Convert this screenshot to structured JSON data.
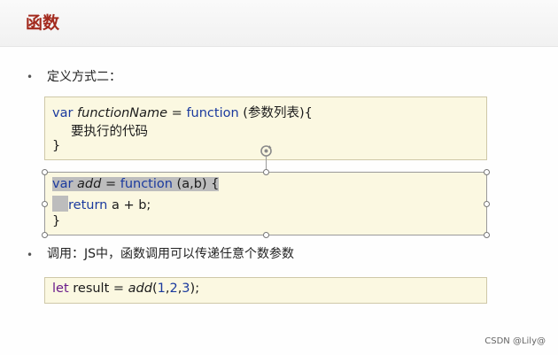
{
  "slide": {
    "title": "函数",
    "bullet1": "定义方式二：",
    "bullet2": "调用：JS中，函数调用可以传递任意个数参数"
  },
  "code1": {
    "l1_var": "var ",
    "l1_name": "functionName",
    "l1_eq": " = ",
    "l1_kw": "function",
    "l1_rest": " (参数列表){",
    "l2": "要执行的代码",
    "l3": "}"
  },
  "code2": {
    "l1_var": "var ",
    "l1_name": "add",
    "l1_eq": " = ",
    "l1_kw": "function",
    "l1_rest": " (a,b) {",
    "l2_kw": "return",
    "l2_rest": " a + b;",
    "l3": "}"
  },
  "code3": {
    "let": "let",
    "mid": " result = ",
    "fn": "add",
    "open": "(",
    "n1": "1",
    "c1": ",",
    "n2": "2",
    "c2": ",",
    "n3": "3",
    "close": ");"
  },
  "watermark": "CSDN @Lily@",
  "icons": [
    "rotate-handle-icon"
  ],
  "colors": {
    "title": "#a32a1e",
    "keyword": "#1b3a9e",
    "box_bg": "#fbf8e1",
    "let": "#6a1b8a"
  }
}
